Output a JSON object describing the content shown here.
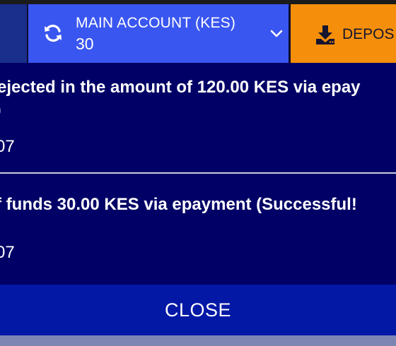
{
  "header": {
    "account_label": "MAIN ACCOUNT (KES)",
    "balance": "30",
    "deposit_label": "DEPOS"
  },
  "transactions": [
    {
      "line1": "ejected in the amount of 120.00 KES via epay",
      "line2": ")",
      "ref": "07"
    },
    {
      "line1": "f funds 30.00 KES via epayment (Successful!",
      "ref": "07"
    }
  ],
  "dialog": {
    "close_label": "CLOSE"
  },
  "colors": {
    "background": "#000066",
    "account_button": "#3a56f0",
    "deposit_button": "#f58f0b",
    "close_button": "#0418a6"
  },
  "icons": {
    "refresh": "refresh-icon",
    "chevron": "chevron-down-icon",
    "deposit": "download-icon"
  }
}
